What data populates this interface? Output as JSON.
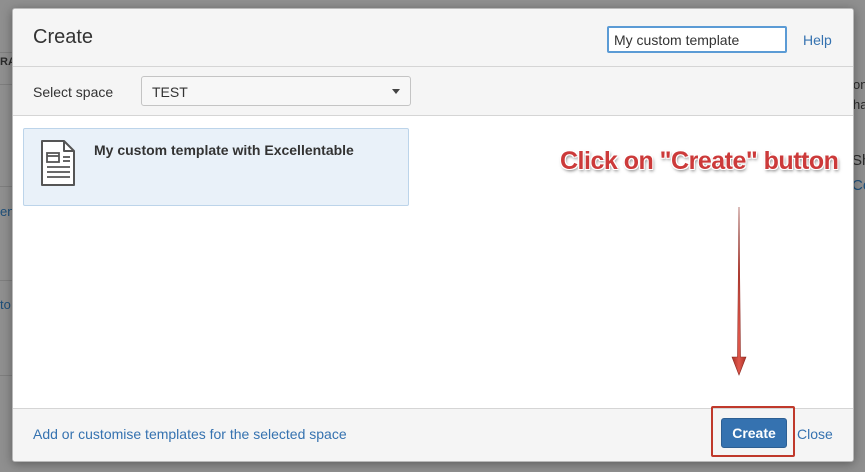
{
  "background": {
    "fragments": [
      "RA",
      "on",
      "ha",
      "Sh",
      "Co",
      "en",
      "to"
    ]
  },
  "dialog": {
    "title": "Create",
    "search": {
      "value": "My custom template",
      "placeholder": ""
    },
    "help_label": "Help",
    "space": {
      "label": "Select space",
      "selected": "TEST"
    },
    "templates": [
      {
        "name": "My custom template with Excellentable",
        "icon": "document-icon",
        "selected": true
      }
    ],
    "annotation": "Click on \"Create\" button",
    "footer": {
      "customise_link": "Add or customise templates for the selected space",
      "create_label": "Create",
      "close_label": "Close"
    }
  },
  "colors": {
    "accent": "#3572b0",
    "annotation": "#cc3a3a",
    "highlight_border": "#c0392b",
    "selected_card": "#e9f1f9"
  }
}
